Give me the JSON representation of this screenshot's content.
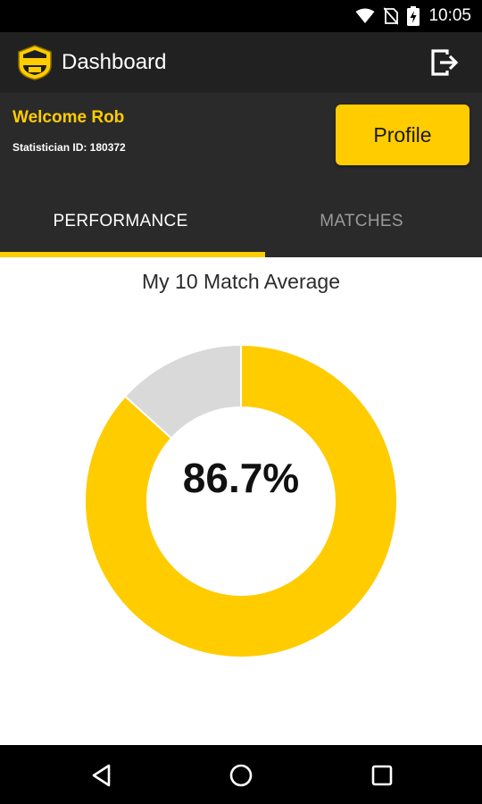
{
  "status_bar": {
    "time": "10:05",
    "icons": [
      "wifi-icon",
      "no-sim-icon",
      "battery-charging-icon"
    ]
  },
  "app_bar": {
    "title": "Dashboard",
    "logo_icon": "app-logo-badge",
    "logout_icon": "logout-icon"
  },
  "header": {
    "welcome": "Welcome Rob",
    "statistician_id": "Statistician ID: 180372",
    "profile_label": "Profile"
  },
  "tabs": [
    {
      "label": "PERFORMANCE",
      "selected": true
    },
    {
      "label": "MATCHES",
      "selected": false
    }
  ],
  "chart_data": {
    "type": "pie",
    "title": "My 10 Match Average",
    "center_label": "86.7%",
    "slices": [
      {
        "value": 86.7,
        "color": "#ffcc00"
      },
      {
        "value": 13.3,
        "color": "#d9d9d9"
      }
    ]
  },
  "nav_bar": {
    "icons": [
      "back-icon",
      "home-icon",
      "recents-icon"
    ]
  },
  "colors": {
    "accent": "#ffcc00",
    "dark": "#212121",
    "panel": "#2a2a2a"
  }
}
